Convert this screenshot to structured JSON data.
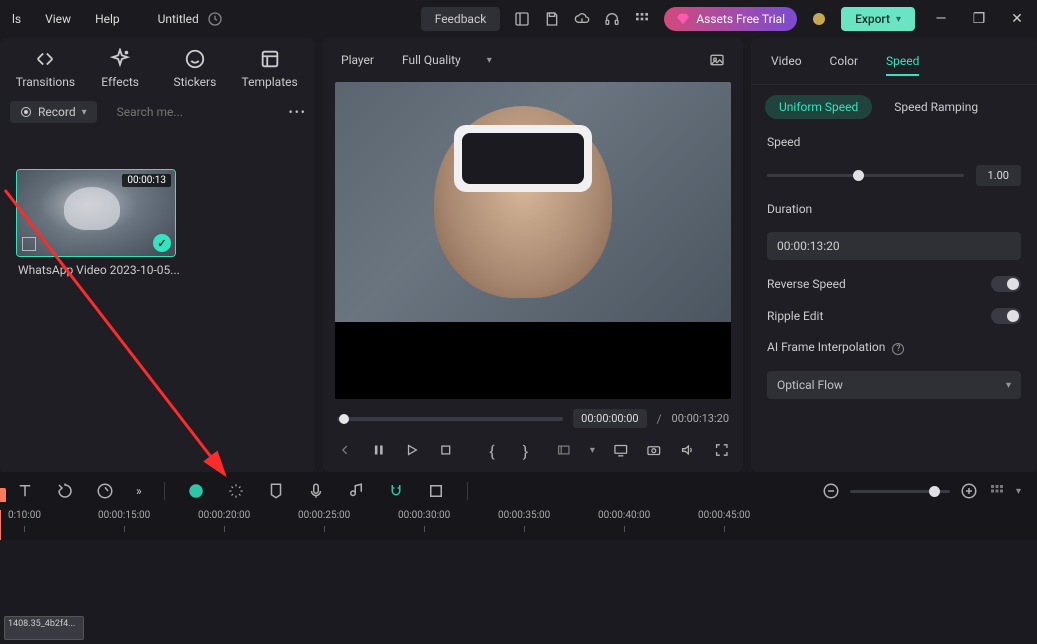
{
  "titlebar": {
    "menu": {
      "tools_partial": "ls",
      "view": "View",
      "help": "Help"
    },
    "title": "Untitled",
    "feedback": "Feedback",
    "assets_trial": "Assets Free Trial",
    "export": "Export"
  },
  "left_panel": {
    "tabs": {
      "transitions": "Transitions",
      "effects": "Effects",
      "stickers": "Stickers",
      "templates": "Templates"
    },
    "record": "Record",
    "search_placeholder": "Search me...",
    "clip": {
      "duration_badge": "00:00:13",
      "name": "WhatsApp Video 2023-10-05..."
    }
  },
  "player": {
    "label": "Player",
    "quality": "Full Quality",
    "current_time": "00:00:00:00",
    "total_time": "00:00:13:20"
  },
  "right_panel": {
    "tabs": {
      "video": "Video",
      "color": "Color",
      "speed": "Speed"
    },
    "subtabs": {
      "uniform": "Uniform Speed",
      "ramping": "Speed Ramping"
    },
    "speed_label": "Speed",
    "speed_value": "1.00",
    "duration_label": "Duration",
    "duration_value": "00:00:13:20",
    "reverse_label": "Reverse Speed",
    "ripple_label": "Ripple Edit",
    "ai_interp_label": "AI Frame Interpolation",
    "ai_interp_value": "Optical Flow"
  },
  "timeline": {
    "ticks": [
      "0:10:00",
      "00:00:15:00",
      "00:00:20:00",
      "00:00:25:00",
      "00:00:30:00",
      "00:00:35:00",
      "00:00:40:00",
      "00:00:45:00"
    ],
    "clip_label": "1408.35_4b2f4..."
  },
  "icons": {
    "save": "save-icon",
    "cloud": "cloud-icon",
    "headset": "headset-icon",
    "grid": "grid-icon",
    "gem": "gem-icon",
    "globe": "globe-icon"
  }
}
